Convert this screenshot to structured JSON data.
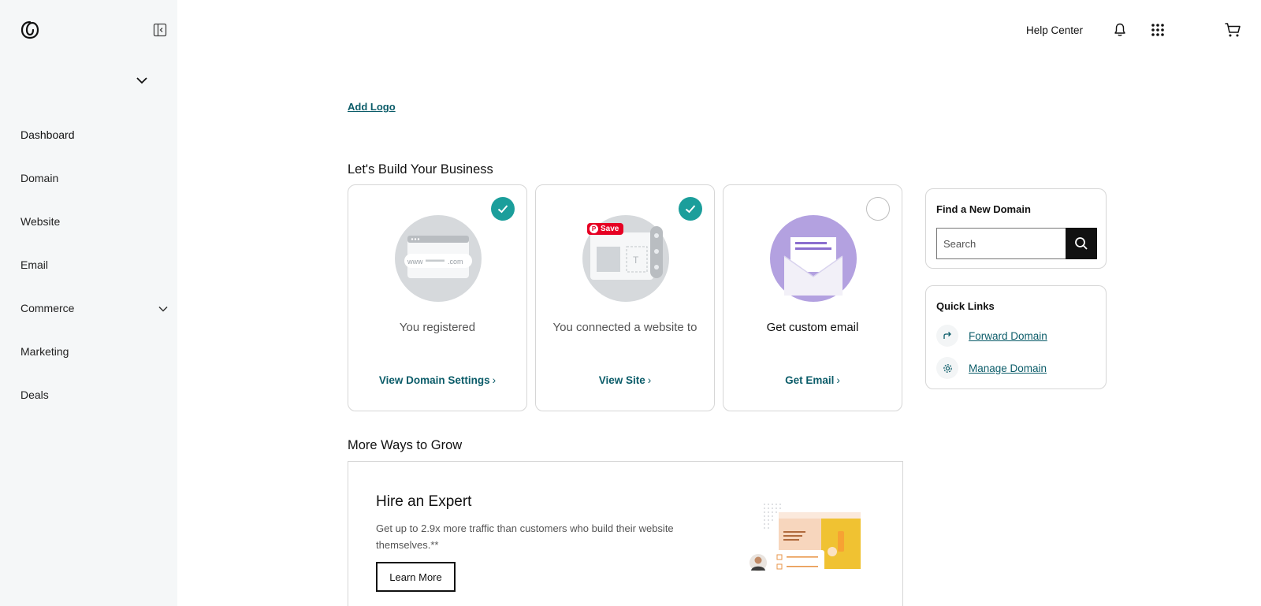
{
  "header": {
    "help_label": "Help Center"
  },
  "sidebar": {
    "items": [
      {
        "label": "Dashboard"
      },
      {
        "label": "Domain"
      },
      {
        "label": "Website"
      },
      {
        "label": "Email"
      },
      {
        "label": "Commerce"
      },
      {
        "label": "Marketing"
      },
      {
        "label": "Deals"
      }
    ]
  },
  "main": {
    "add_logo": "Add Logo",
    "build_title": "Let's Build Your Business",
    "cards": [
      {
        "text": "You registered",
        "link": "View Domain Settings",
        "checked": true,
        "icon": "domain-illustration"
      },
      {
        "text": "You connected a website to",
        "link": "View Site",
        "checked": true,
        "icon": "website-illustration",
        "badge": "Save"
      },
      {
        "text": "Get custom email",
        "link": "Get Email",
        "checked": false,
        "icon": "email-illustration"
      }
    ],
    "grow_title": "More Ways to Grow",
    "grow_card": {
      "title": "Hire an Expert",
      "description": "Get up to 2.9x more traffic than customers who build their website themselves.**",
      "button": "Learn More"
    }
  },
  "find_domain": {
    "title": "Find a New Domain",
    "placeholder": "Search"
  },
  "quick_links": {
    "title": "Quick Links",
    "items": [
      {
        "label": "Forward Domain",
        "icon": "forward-arrow-icon"
      },
      {
        "label": "Manage Domain",
        "icon": "gear-icon"
      }
    ]
  },
  "colors": {
    "accent": "#1b9e9b",
    "link": "#0b5c69",
    "sidebar_bg": "#f5f7f8",
    "email_purple": "#b3a1e0"
  }
}
